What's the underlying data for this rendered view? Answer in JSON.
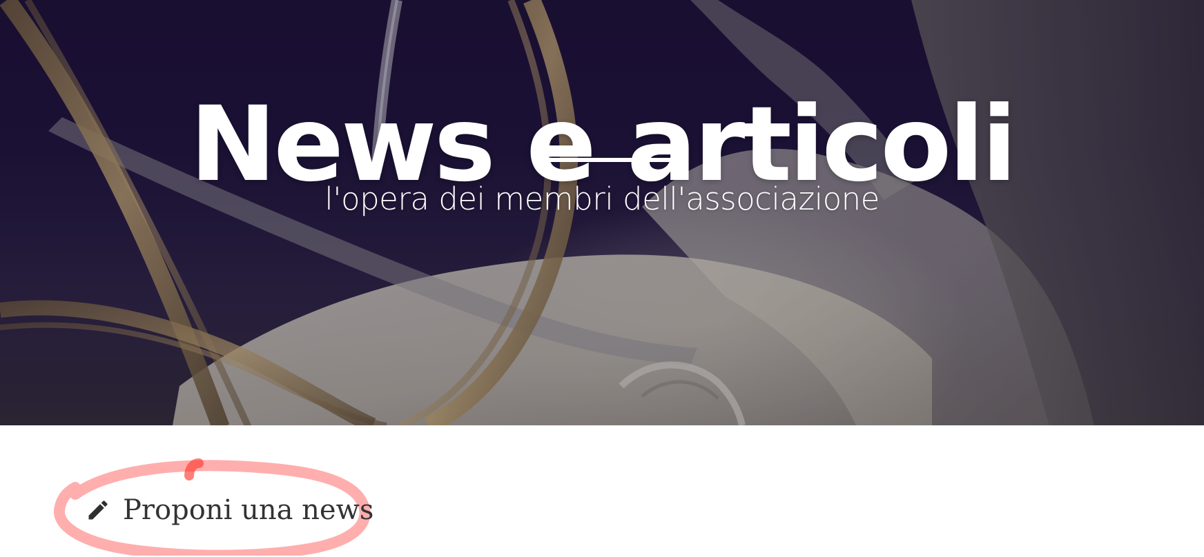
{
  "hero": {
    "title": "News e articoli",
    "subtitle": "l'opera dei membri dell'associazione",
    "image_icon": "space-walk-photo"
  },
  "cta": {
    "label": "Proponi una news",
    "icon": "pencil-icon"
  },
  "annotation": {
    "type": "hand-drawn-circle",
    "color": "#ff6b6b"
  },
  "colors": {
    "hero_text": "#ffffff",
    "hero_bg": "#1c1338",
    "cta_text": "#333333",
    "annotation": "#ff6b6b"
  }
}
